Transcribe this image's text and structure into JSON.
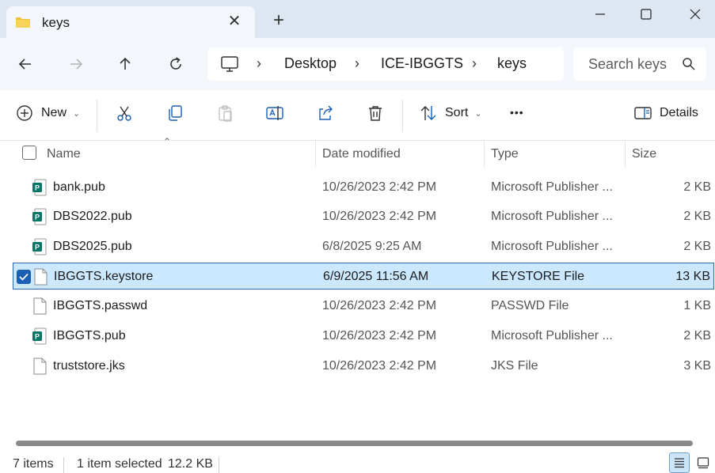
{
  "tab": {
    "title": "keys",
    "close_glyph": "✕",
    "new_tab_glyph": "+"
  },
  "window": {
    "minimize": "minimize-icon",
    "maximize": "maximize-icon",
    "close": "close-icon"
  },
  "breadcrumbs": [
    "Desktop",
    "ICE-IBGGTS",
    "keys"
  ],
  "search": {
    "placeholder": "Search keys"
  },
  "toolbar": {
    "new_label": "New",
    "sort_label": "Sort",
    "details_label": "Details",
    "more_glyph": "•••"
  },
  "columns": {
    "name": "Name",
    "date": "Date modified",
    "type": "Type",
    "size": "Size"
  },
  "files": [
    {
      "name": "bank.pub",
      "date": "10/26/2023 2:42 PM",
      "type": "Microsoft Publisher ...",
      "size": "2 KB",
      "icon": "publisher-file-icon"
    },
    {
      "name": "DBS2022.pub",
      "date": "10/26/2023 2:42 PM",
      "type": "Microsoft Publisher ...",
      "size": "2 KB",
      "icon": "publisher-file-icon"
    },
    {
      "name": "DBS2025.pub",
      "date": "6/8/2025 9:25 AM",
      "type": "Microsoft Publisher ...",
      "size": "2 KB",
      "icon": "publisher-file-icon"
    },
    {
      "name": "IBGGTS.keystore",
      "date": "6/9/2025 11:56 AM",
      "type": "KEYSTORE File",
      "size": "13 KB",
      "icon": "blank-file-icon",
      "selected": true
    },
    {
      "name": "IBGGTS.passwd",
      "date": "10/26/2023 2:42 PM",
      "type": "PASSWD File",
      "size": "1 KB",
      "icon": "blank-file-icon"
    },
    {
      "name": "IBGGTS.pub",
      "date": "10/26/2023 2:42 PM",
      "type": "Microsoft Publisher ...",
      "size": "2 KB",
      "icon": "publisher-file-icon"
    },
    {
      "name": "truststore.jks",
      "date": "10/26/2023 2:42 PM",
      "type": "JKS File",
      "size": "3 KB",
      "icon": "blank-file-icon"
    }
  ],
  "status": {
    "items": "7 items",
    "selected": "1 item selected",
    "selected_size": "12.2 KB"
  },
  "colors": {
    "accent": "#1a5fb4",
    "selection": "#cce8ff",
    "publisher": "#077568",
    "titlebar": "#dde6f1"
  }
}
